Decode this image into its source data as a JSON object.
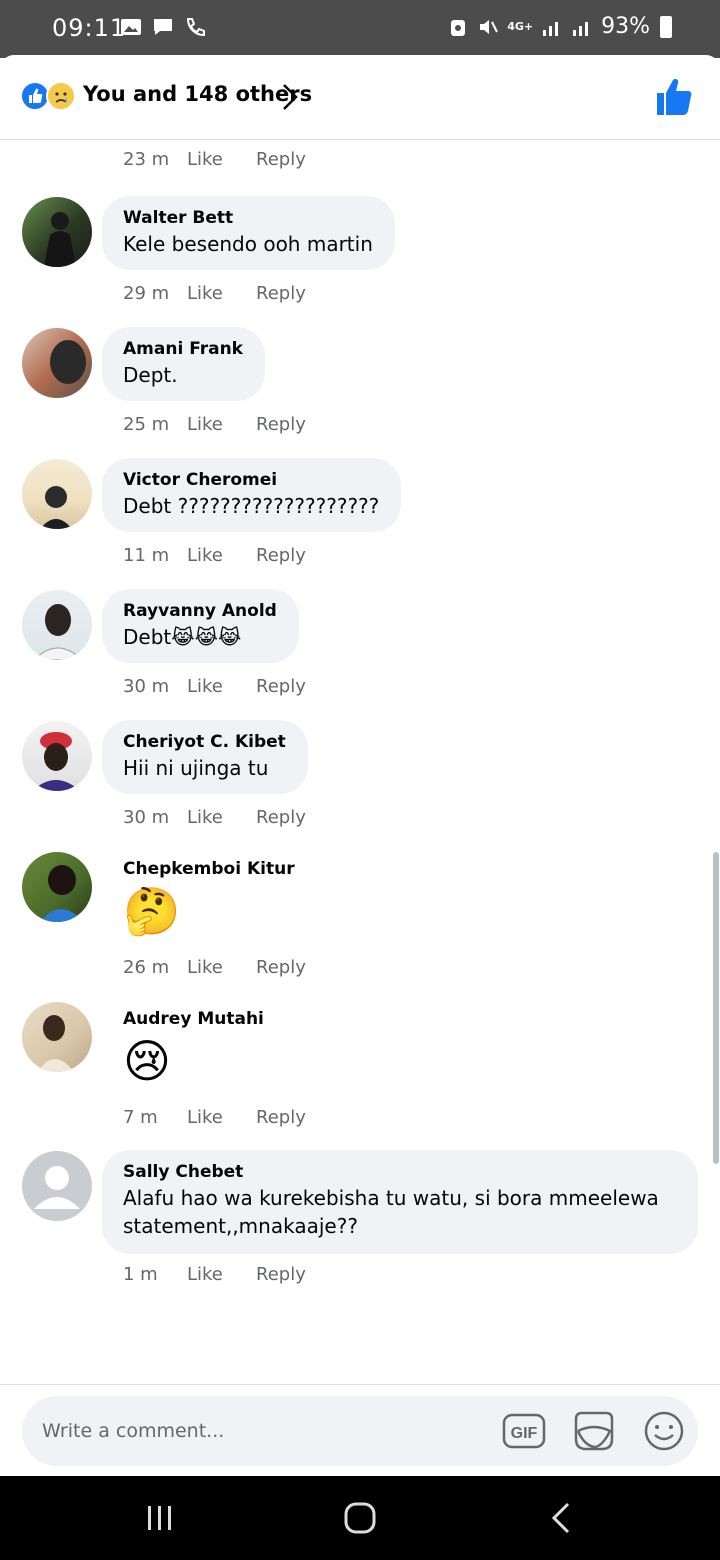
{
  "status_bar": {
    "time": "09:11",
    "network": "4G+",
    "battery": "93%"
  },
  "reactions": {
    "summary": "You and 148 others"
  },
  "top_meta": {
    "time": "23 m",
    "like": "Like",
    "reply": "Reply"
  },
  "comments": [
    {
      "author": "Walter Bett",
      "text": "Kele besendo ooh martin",
      "time": "29 m",
      "like": "Like",
      "reply": "Reply"
    },
    {
      "author": "Amani Frank",
      "text": "Dept.",
      "time": "25 m",
      "like": "Like",
      "reply": "Reply"
    },
    {
      "author": "Victor Cheromei",
      "text": "Debt ???????????????????",
      "time": "11 m",
      "like": "Like",
      "reply": "Reply"
    },
    {
      "author": "Rayvanny Anold",
      "text": "Debt😹😹😹",
      "time": "30 m",
      "like": "Like",
      "reply": "Reply"
    },
    {
      "author": "Cheriyot C. Kibet",
      "text": "Hii ni ujinga tu",
      "time": "30 m",
      "like": "Like",
      "reply": "Reply"
    },
    {
      "author": "Chepkemboi Kitur",
      "text": "🤔",
      "time": "26 m",
      "like": "Like",
      "reply": "Reply"
    },
    {
      "author": "Audrey Mutahi",
      "text": "😢",
      "time": "7 m",
      "like": "Like",
      "reply": "Reply"
    },
    {
      "author": "Sally Chebet",
      "text": "Alafu hao wa kurekebisha tu watu, si bora mmeelewa statement,,mnakaaje??",
      "time": "1 m",
      "like": "Like",
      "reply": "Reply"
    }
  ],
  "composer": {
    "placeholder": "Write a comment...",
    "gif_label": "GIF"
  },
  "colors": {
    "accent": "#1877f2",
    "bubble": "#f0f2f5",
    "meta": "#65676b"
  }
}
